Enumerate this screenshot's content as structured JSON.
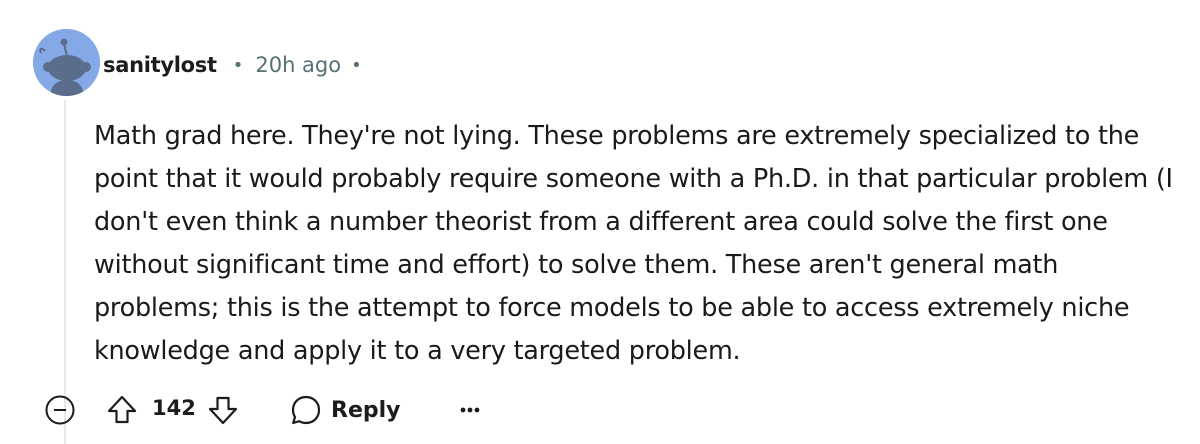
{
  "comment": {
    "author": "sanitylost",
    "separator": "•",
    "timestamp": "20h ago",
    "text": "Math grad here. They're not lying. These problems are extremely specialized to the point that it would probably require someone with a Ph.D. in that particular problem (I don't even think a number theorist from a different area could solve the first one without significant time and effort) to solve them. These aren't general math problems; this is the attempt to force models to be able to access extremely niche knowledge and apply it to a very targeted problem.",
    "avatar_color": "#84a9e6"
  },
  "actions": {
    "vote_count": "142",
    "reply_label": "Reply",
    "collapse_icon": "collapse-icon",
    "upvote_icon": "upvote-arrow-icon",
    "downvote_icon": "downvote-arrow-icon",
    "reply_icon": "speech-bubble-icon",
    "more_icon": "more-options-icon"
  }
}
